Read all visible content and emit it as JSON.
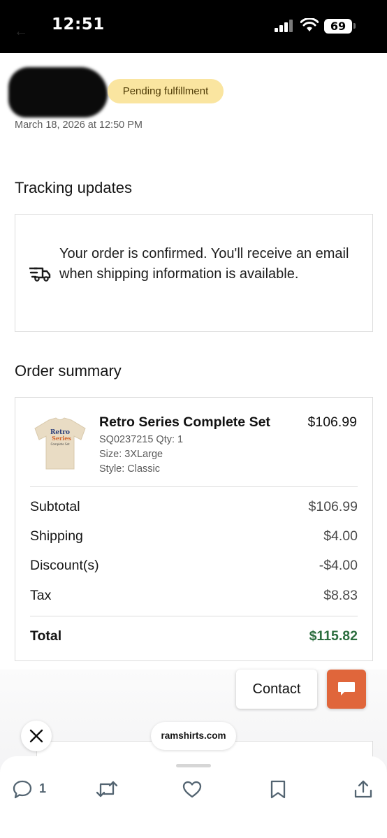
{
  "status_bar": {
    "time": "12:51",
    "battery": "69",
    "colors": {
      "background": "#000000",
      "text": "#ffffff"
    },
    "icons": [
      "cellular-signal-icon",
      "wifi-icon",
      "battery-icon"
    ]
  },
  "order": {
    "status_badge": "Pending fulfillment",
    "date": "March 18, 2026 at 12:50 PM"
  },
  "tracking": {
    "title": "Tracking updates",
    "message": "Your order is confirmed. You'll receive an email when shipping information is available.",
    "icon": "delivery-truck-icon"
  },
  "summary": {
    "title": "Order summary",
    "item": {
      "name": "Retro Series Complete Set",
      "price": "$106.99",
      "sku_qty": "SQ0237215 Qty: 1",
      "size": "Size: 3XLarge",
      "style": "Style: Classic",
      "image_text": [
        "Retro",
        "Series",
        "Complete Set"
      ]
    },
    "rows": [
      {
        "label": "Subtotal",
        "value": "$106.99"
      },
      {
        "label": "Shipping",
        "value": "$4.00"
      },
      {
        "label": "Discount(s)",
        "value": "-$4.00"
      },
      {
        "label": "Tax",
        "value": "$8.83"
      }
    ],
    "total": {
      "label": "Total",
      "value": "$115.82"
    }
  },
  "overlay": {
    "contact_label": "Contact",
    "domain": "ramshirts.com"
  },
  "action_bar": {
    "reply_count": "1",
    "icons": [
      "reply-icon",
      "repost-icon",
      "like-icon",
      "bookmark-icon",
      "share-icon"
    ]
  },
  "colors": {
    "badge_bg": "#fae5a0",
    "badge_text": "#4f3b05",
    "total_green": "#2c6e3f",
    "chat_orange": "#e0663b",
    "action_gray": "#536471"
  }
}
